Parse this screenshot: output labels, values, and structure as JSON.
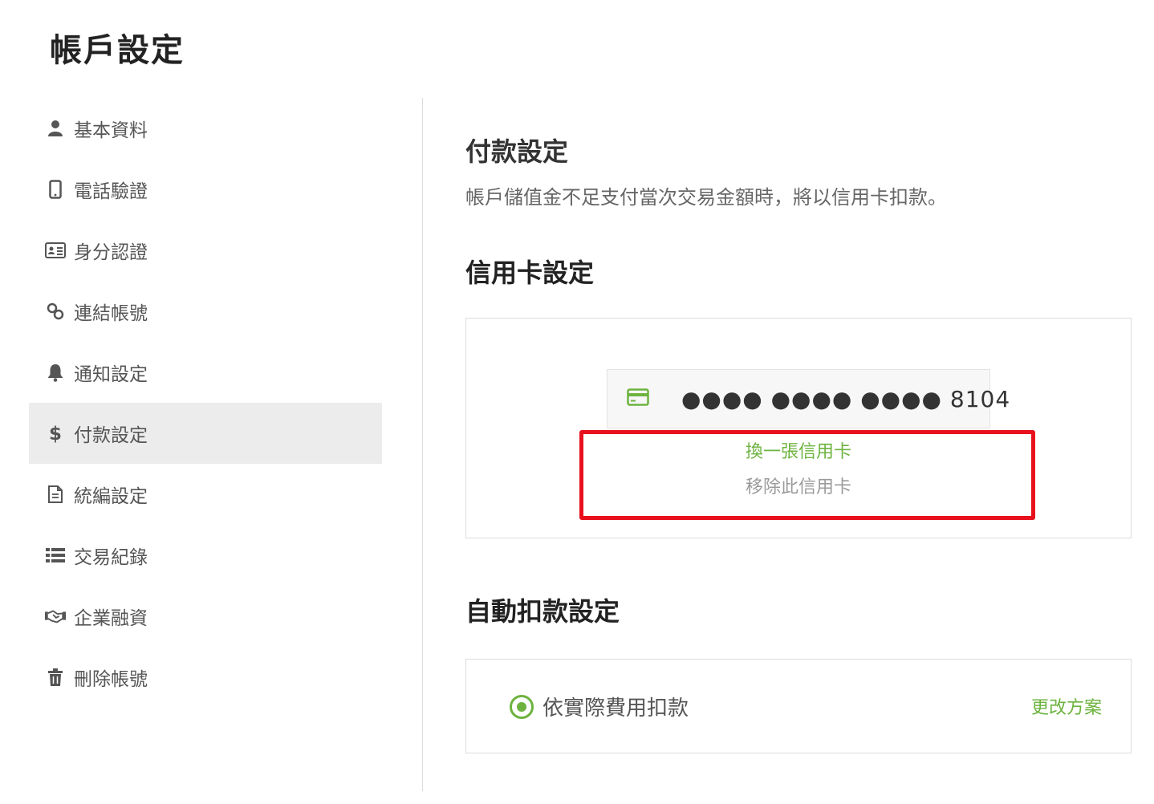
{
  "page": {
    "title": "帳戶設定"
  },
  "sidebar": {
    "items": [
      {
        "label": "基本資料",
        "icon": "user-icon",
        "active": false
      },
      {
        "label": "電話驗證",
        "icon": "mobile-phone-icon",
        "active": false
      },
      {
        "label": "身分認證",
        "icon": "id-card-icon",
        "active": false
      },
      {
        "label": "連結帳號",
        "icon": "link-icon",
        "active": false
      },
      {
        "label": "通知設定",
        "icon": "bell-icon",
        "active": false
      },
      {
        "label": "付款設定",
        "icon": "dollar-icon",
        "active": true
      },
      {
        "label": "統編設定",
        "icon": "document-icon",
        "active": false
      },
      {
        "label": "交易紀錄",
        "icon": "list-icon",
        "active": false
      },
      {
        "label": "企業融資",
        "icon": "handshake-icon",
        "active": false
      },
      {
        "label": "刪除帳號",
        "icon": "trash-icon",
        "active": false
      }
    ]
  },
  "payment": {
    "heading": "付款設定",
    "description": "帳戶儲值金不足支付當次交易金額時，將以信用卡扣款。"
  },
  "credit_card": {
    "heading": "信用卡設定",
    "icon": "credit-card-icon",
    "masked_number": "●●●● ●●●● ●●●● 8104",
    "change_label": "換一張信用卡",
    "remove_label": "移除此信用卡"
  },
  "auto_debit": {
    "heading": "自動扣款設定",
    "option_label": "依實際費用扣款",
    "option_selected": true,
    "change_plan_label": "更改方案"
  },
  "colors": {
    "accent_green": "#6db33f",
    "highlight_red": "#e8101d",
    "active_nav_bg": "#ececec",
    "muted_text": "#9b9b9b"
  }
}
